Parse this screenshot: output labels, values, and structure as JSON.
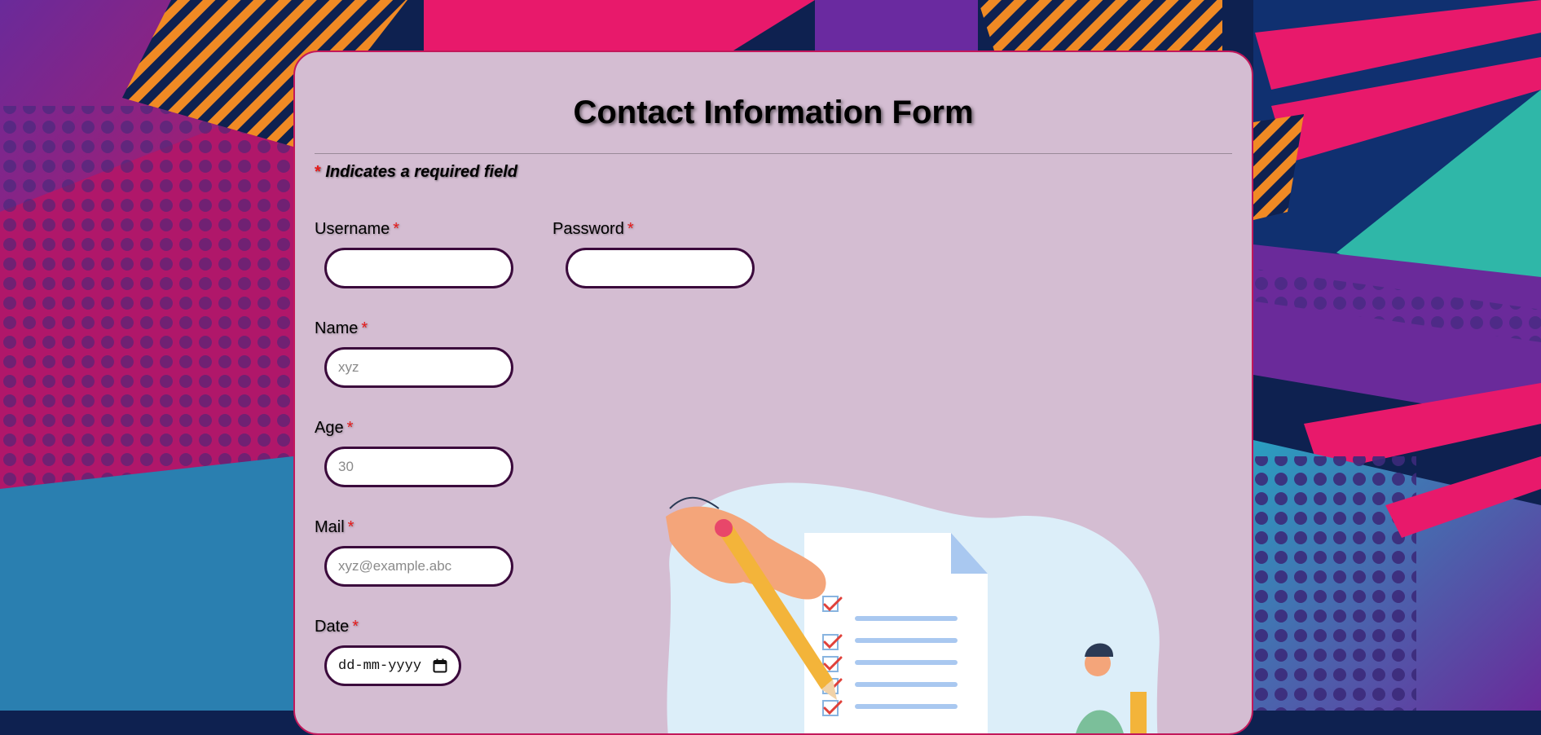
{
  "form": {
    "title": "Contact Information Form",
    "required_note": "Indicates a required field",
    "required_marker": "*",
    "fields": {
      "username": {
        "label": "Username",
        "value": "",
        "placeholder": ""
      },
      "password": {
        "label": "Password",
        "value": "",
        "placeholder": ""
      },
      "name": {
        "label": "Name",
        "value": "",
        "placeholder": "xyz"
      },
      "age": {
        "label": "Age",
        "value": "",
        "placeholder": "30"
      },
      "mail": {
        "label": "Mail",
        "value": "",
        "placeholder": "xyz@example.abc"
      },
      "date": {
        "label": "Date",
        "value": "dd-mm-yyyy"
      }
    }
  },
  "icons": {
    "calendar": "calendar-icon",
    "illustration": "checklist-illustration"
  },
  "colors": {
    "card_bg": "#d4bdd2",
    "card_border": "#c2185b",
    "field_border": "#3b0a3c",
    "required": "#e81b1b"
  }
}
